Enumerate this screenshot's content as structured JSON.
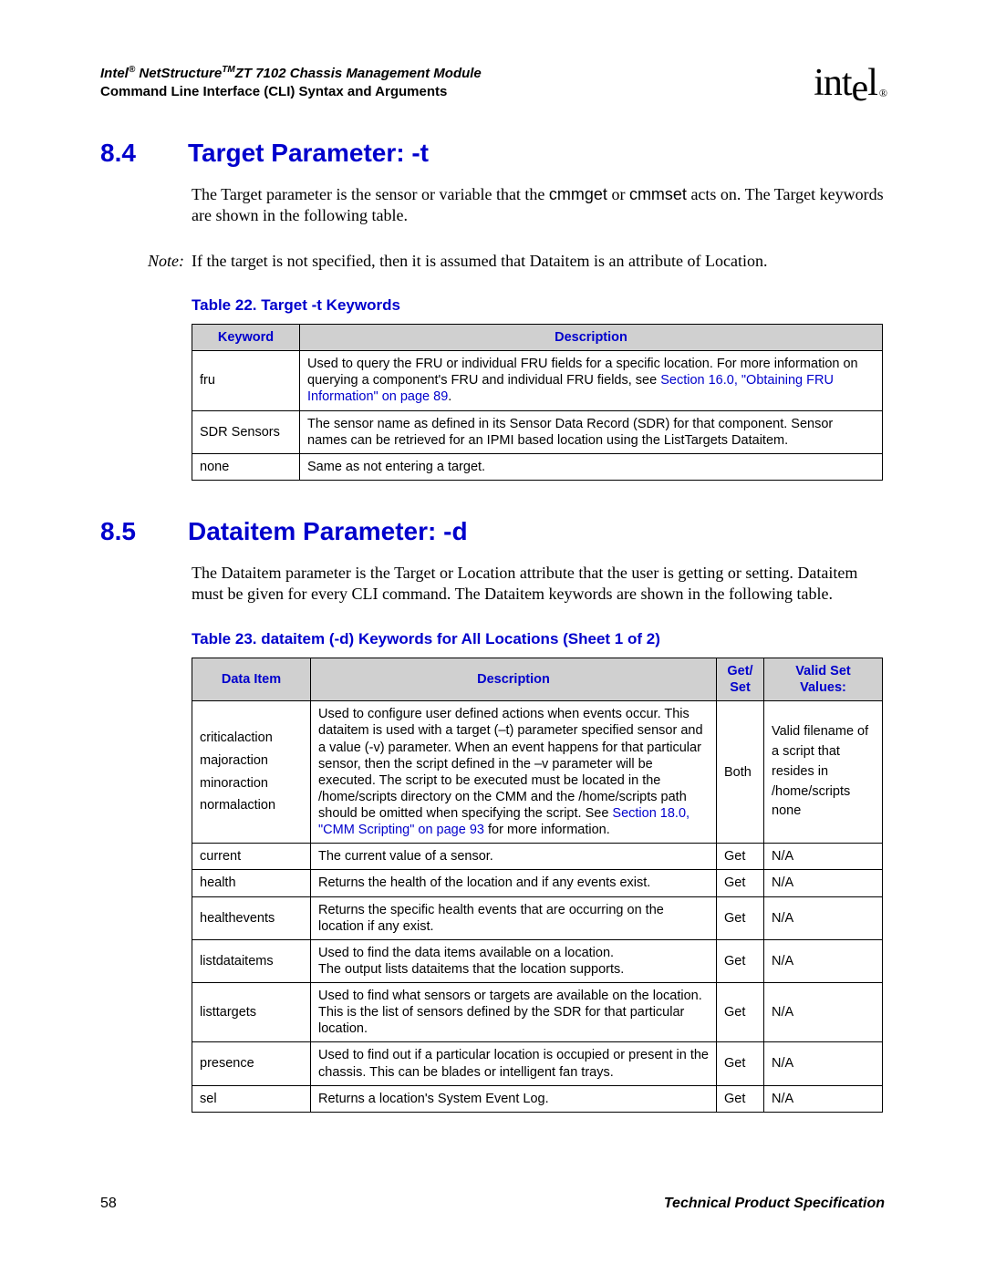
{
  "header": {
    "product_line_italic_prefix": "Intel",
    "product_line_italic_rest": " NetStructure",
    "product_line_model": "ZT 7102 Chassis Management Module",
    "subtitle": "Command Line Interface (CLI) Syntax and Arguments",
    "logo_text": "intel",
    "tm": "TM",
    "reg": "®"
  },
  "sections": {
    "s84": {
      "num": "8.4",
      "title": "Target Parameter: -t",
      "para_pre": "The Target parameter is the sensor or variable that the ",
      "cmd1": "cmmget",
      "mid": " or ",
      "cmd2": "cmmset",
      "para_post": " acts on. The Target keywords are shown in the following table.",
      "note_label": "Note:",
      "note_text": "If the target is not specified, then it is assumed that Dataitem is an attribute of Location."
    },
    "s85": {
      "num": "8.5",
      "title": "Dataitem Parameter: -d",
      "para": "The Dataitem parameter is the Target or Location attribute that the user is getting or setting. Dataitem must be given for every CLI command. The Dataitem keywords are shown in the following table."
    }
  },
  "table22": {
    "caption": "Table 22. Target -t Keywords",
    "headers": {
      "c1": "Keyword",
      "c2": "Description"
    },
    "rows": [
      {
        "keyword": "fru",
        "desc_pre": "Used to query the FRU or individual FRU fields for a specific location. For more information on querying a component's FRU and individual FRU fields, see ",
        "desc_link": "Section 16.0, \"Obtaining FRU Information\" on page 89",
        "desc_post": "."
      },
      {
        "keyword": "SDR Sensors",
        "desc": "The sensor name as defined in its Sensor Data Record (SDR) for that component. Sensor names can be retrieved for an IPMI based location using the ListTargets Dataitem."
      },
      {
        "keyword": "none",
        "desc": "Same as not entering a target."
      }
    ]
  },
  "table23": {
    "caption": "Table 23. dataitem (-d) Keywords for All Locations (Sheet 1 of 2)",
    "headers": {
      "c1": "Data Item",
      "c2": "Description",
      "c3": "Get/\nSet",
      "c4": "Valid Set Values:"
    },
    "rows": [
      {
        "dataitem": "criticalaction\nmajoraction\nminoraction\nnormalaction",
        "desc_pre": "Used to configure user defined actions when events occur. This dataitem is used with a target (–t) parameter specified sensor and a value (-v) parameter. When an event happens for that particular sensor, then the script defined in the –v parameter will be executed. The script to be executed must be located in the /home/scripts directory on the CMM and the /home/scripts path should be omitted when specifying the script. See ",
        "desc_link": "Section 18.0, \"CMM Scripting\" on page 93",
        "desc_post": " for more information.",
        "getset": "Both",
        "values": "Valid filename of a script that resides in\n/home/scripts\nnone"
      },
      {
        "dataitem": "current",
        "desc": "The current value of a sensor.",
        "getset": "Get",
        "values": "N/A"
      },
      {
        "dataitem": "health",
        "desc": "Returns the health of the location and if any events exist.",
        "getset": "Get",
        "values": "N/A"
      },
      {
        "dataitem": "healthevents",
        "desc": "Returns the specific health events that are occurring on the location if any exist.",
        "getset": "Get",
        "values": "N/A"
      },
      {
        "dataitem": "listdataitems",
        "desc": "Used to find the data items available on a location.\nThe output lists dataitems that the location supports.",
        "getset": "Get",
        "values": "N/A"
      },
      {
        "dataitem": "listtargets",
        "desc": "Used to find what sensors or targets are available on the location. This is the list of sensors defined by the SDR for that particular location.",
        "getset": "Get",
        "values": "N/A"
      },
      {
        "dataitem": "presence",
        "desc": "Used to find out if a particular location is occupied or present in the chassis. This can be blades or intelligent fan trays.",
        "getset": "Get",
        "values": "N/A"
      },
      {
        "dataitem": "sel",
        "desc": "Returns a location's System Event Log.",
        "getset": "Get",
        "values": "N/A"
      }
    ]
  },
  "footer": {
    "page": "58",
    "right": "Technical Product Specification"
  }
}
